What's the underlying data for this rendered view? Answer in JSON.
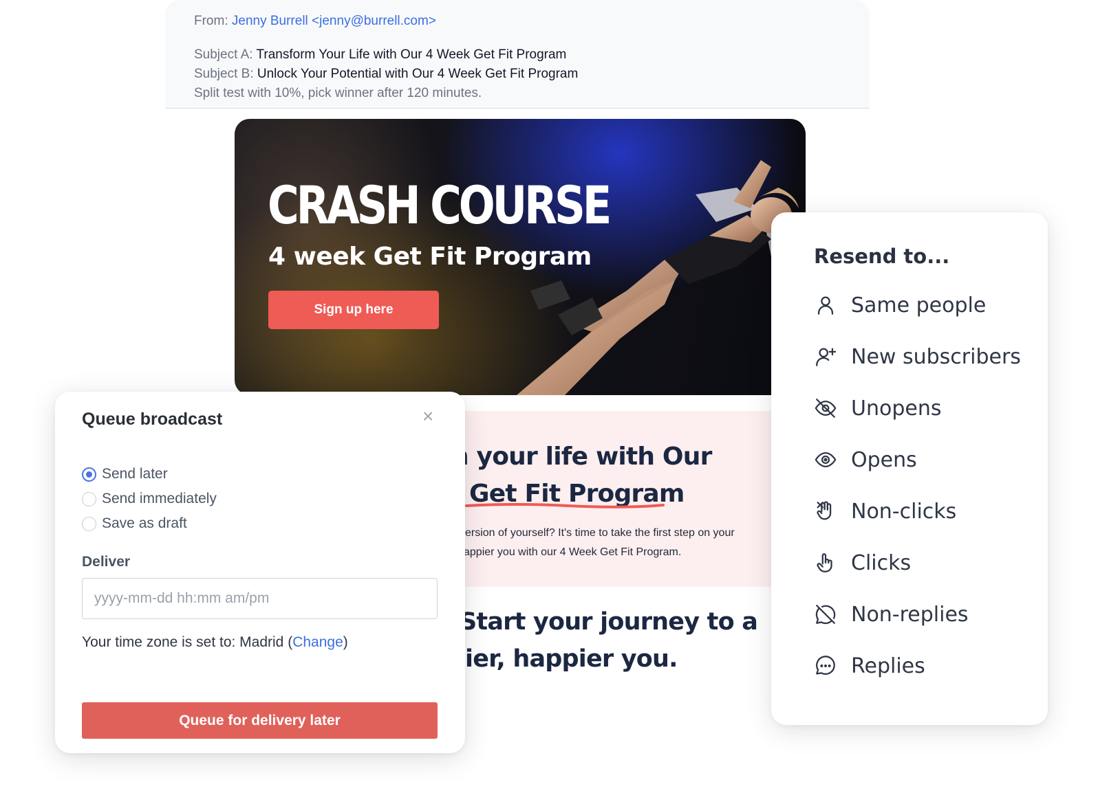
{
  "email": {
    "from_label": "From:",
    "from_value": "Jenny Burrell <jenny@burrell.com>",
    "subject_a_label": "Subject A:",
    "subject_a_value": "Transform Your Life with Our 4 Week Get Fit Program",
    "subject_b_label": "Subject B:",
    "subject_b_value": "Unlock Your Potential with Our 4 Week Get Fit Program",
    "split_test": "Split test with 10%, pick winner after 120 minutes."
  },
  "hero": {
    "title": "CRASH COURSE",
    "subtitle": "4 week Get Fit Program",
    "cta_label": "Sign up here"
  },
  "pink_section": {
    "heading_line1": "n your life with Our",
    "heading_line2": "Get Fit Program",
    "body_line1": "ersion of yourself? It's time to take the first step on your",
    "body_line2": "appier you with our 4 Week Get Fit Program."
  },
  "journey": {
    "line1": "Start your journey to a",
    "line2": "ier, happier you."
  },
  "modal": {
    "title": "Queue broadcast",
    "close": "×",
    "options": [
      "Send later",
      "Send immediately",
      "Save as draft"
    ],
    "selected_option": "Send later",
    "deliver_label": "Deliver",
    "deliver_placeholder": "yyyy-mm-dd hh:mm am/pm",
    "timezone_prefix": "Your time zone is set to: Madrid (",
    "timezone_link": "Change",
    "timezone_suffix": ")",
    "submit_label": "Queue for delivery later"
  },
  "resend": {
    "title": "Resend to...",
    "items": [
      {
        "label": "Same people",
        "icon": "user-icon"
      },
      {
        "label": "New subscribers",
        "icon": "user-plus-icon"
      },
      {
        "label": "Unopens",
        "icon": "eye-off-icon"
      },
      {
        "label": "Opens",
        "icon": "eye-icon"
      },
      {
        "label": "Non-clicks",
        "icon": "hand-cross-icon"
      },
      {
        "label": "Clicks",
        "icon": "pointer-hand-icon"
      },
      {
        "label": "Non-replies",
        "icon": "message-off-icon"
      },
      {
        "label": "Replies",
        "icon": "message-dots-icon"
      }
    ]
  },
  "colors": {
    "accent_red": "#ef5b55",
    "link_blue": "#3b6fe0",
    "heading_navy": "#1c2842",
    "pink_bg": "#fdeff0"
  }
}
